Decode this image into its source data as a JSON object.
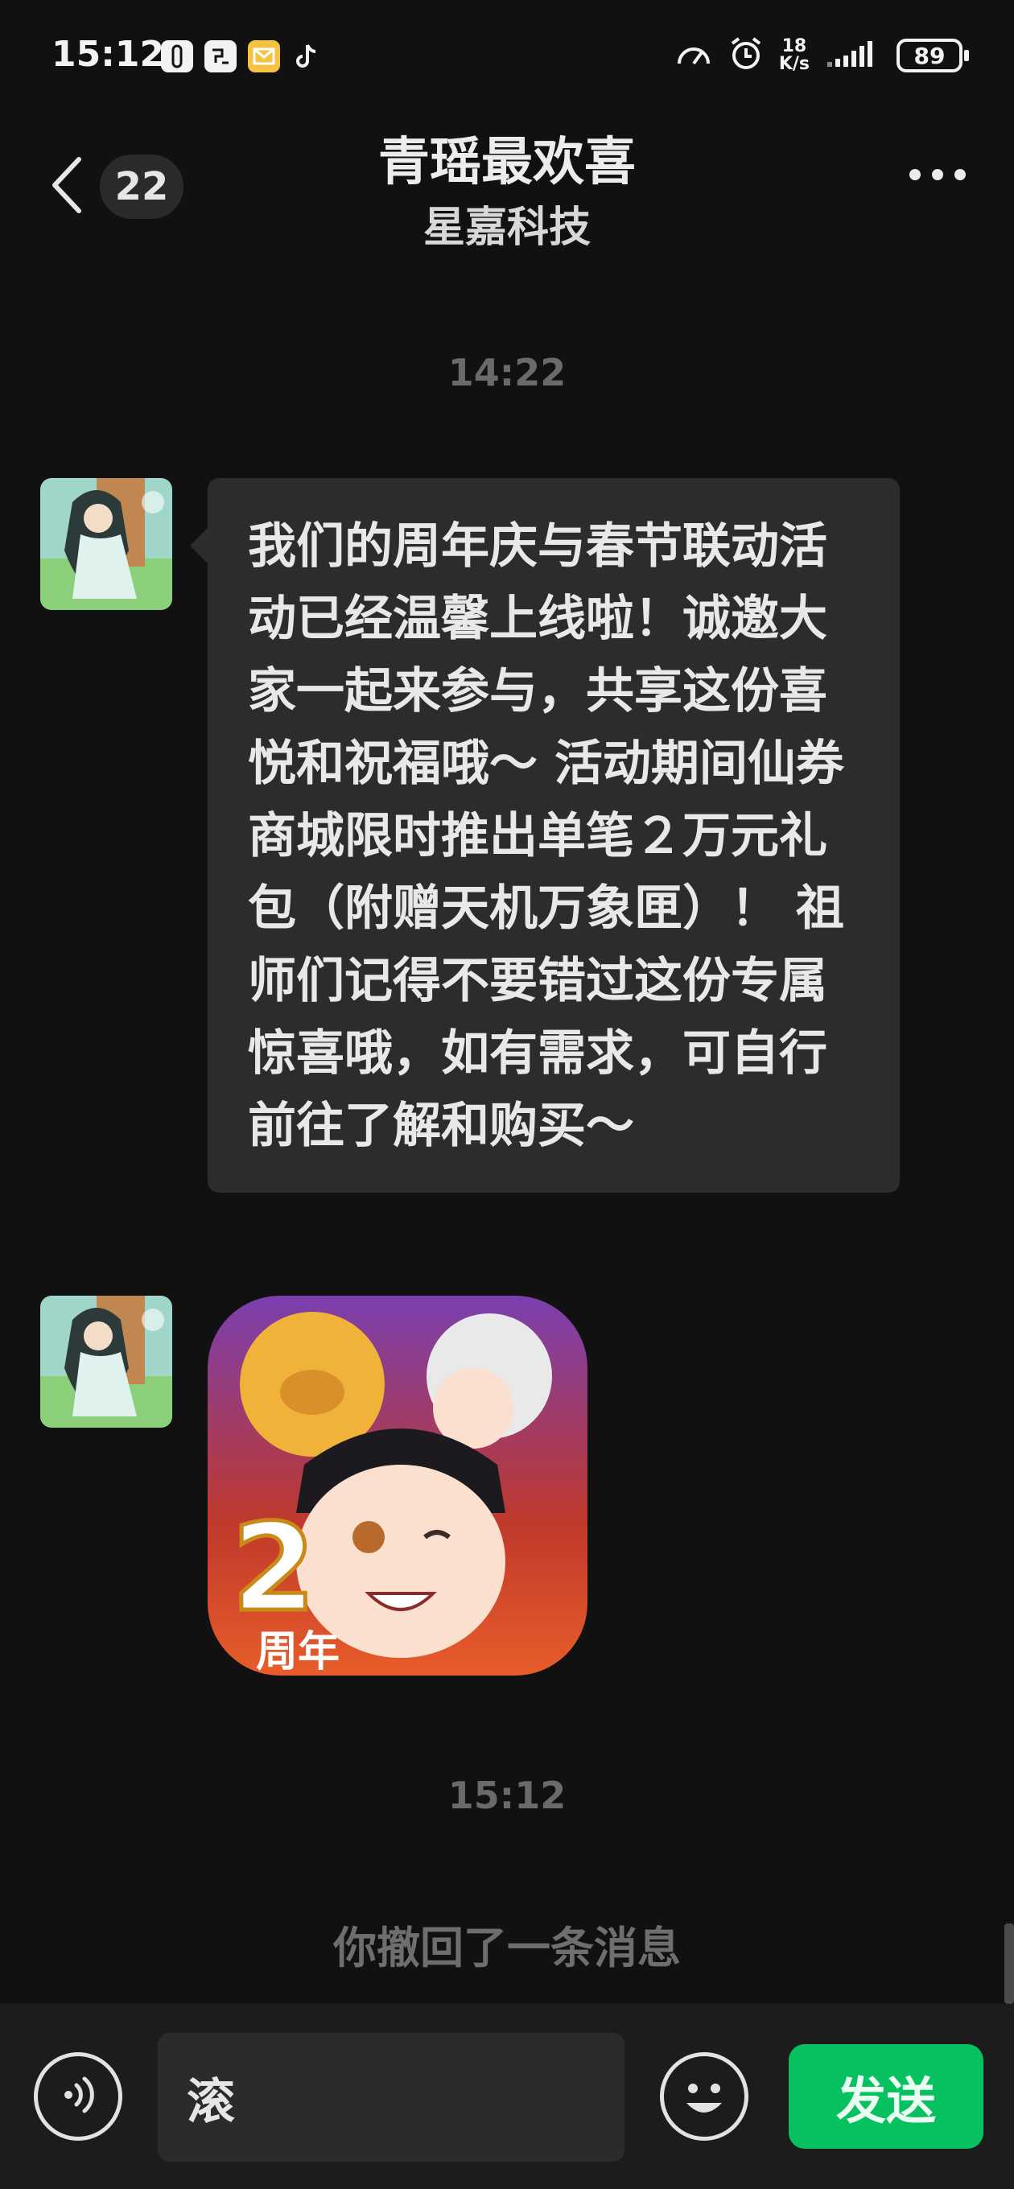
{
  "status_bar": {
    "time": "15:12",
    "network_speed_value": "18",
    "network_speed_unit": "K/s",
    "battery_level": "89",
    "notification_icons": [
      "link-app-icon",
      "sync-app-icon",
      "mail-app-icon",
      "tiktok-icon"
    ],
    "system_icons": [
      "speed-gauge-icon",
      "alarm-icon",
      "signal-icon",
      "battery-icon"
    ]
  },
  "header": {
    "unread_count": "22",
    "title": "青瑶最欢喜",
    "subtitle": "星嘉科技"
  },
  "messages": [
    {
      "type": "time",
      "text": "14:22"
    },
    {
      "type": "text",
      "sender": "incoming",
      "text": "我们的周年庆与春节联动活动已经温馨上线啦！诚邀大家一起来参与，共享这份喜悦和祝福哦～ 活动期间仙券商城限时推出单笔２万元礼包（附赠天机万象匣）！ 祖师们记得不要错过这份专属惊喜哦，如有需求，可自行前往了解和购买～"
    },
    {
      "type": "image",
      "sender": "incoming",
      "image_badge_number": "2",
      "image_badge_text": "周年"
    },
    {
      "type": "time",
      "text": "15:12"
    },
    {
      "type": "system",
      "text": "你撤回了一条消息"
    }
  ],
  "input_bar": {
    "input_value": "滚",
    "send_label": "发送"
  },
  "colors": {
    "background": "#111111",
    "bubble": "#2c2c2c",
    "send_button": "#07c160"
  }
}
